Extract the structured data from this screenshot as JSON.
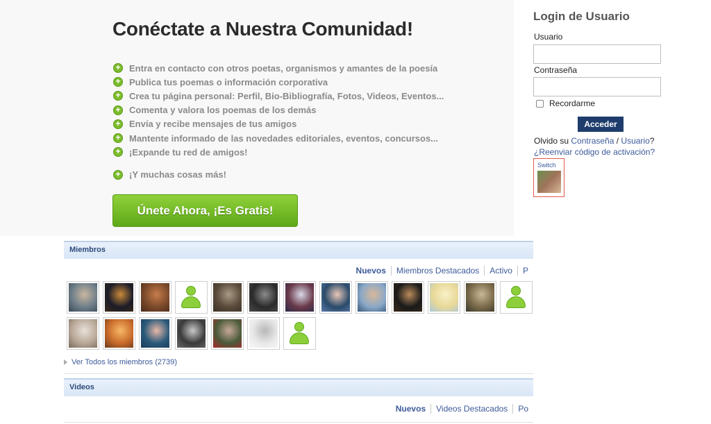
{
  "hero": {
    "title": "Conéctate a Nuestra Comunidad!",
    "features": [
      "Entra en contacto con otros poetas, organismos y amantes de la poesía",
      "Publica tus poemas o información corporativa",
      "Crea tu página personal: Perfil, Bio-Bibliografía, Fotos, Videos, Eventos...",
      "Comenta y valora los poemas de los demás",
      "Envía y recibe mensajes de tus amigos",
      "Mantente informado de las novedades editoriales, eventos, concursos...",
      "¡Expande tu red de amigos!"
    ],
    "more": "¡Y muchas cosas más!",
    "join_label": "Únete Ahora, ¡Es Gratis!",
    "plus_glyph": "+"
  },
  "login": {
    "title": "Login de Usuario",
    "user_label": "Usuario",
    "password_label": "Contraseña",
    "remember_label": "Recordarme",
    "submit_label": "Acceder",
    "forgot_prefix": "Olvido su ",
    "forgot_password": "Contraseña",
    "forgot_sep": " / ",
    "forgot_user": "Usuario",
    "forgot_suffix": "?",
    "resend": "¿Reenviar código de activación?",
    "switch_label": "Switch"
  },
  "members": {
    "title": "Miembros",
    "tabs": [
      "Nuevos",
      "Miembros Destacados",
      "Activo",
      "P"
    ],
    "view_all": "Ver Todos los miembros (2739)",
    "thumbs": [
      {
        "type": "photo",
        "colors": [
          "#6f7f8a",
          "#c9b7a0",
          "#3a4a55"
        ]
      },
      {
        "type": "photo",
        "colors": [
          "#1c1c28",
          "#c98a3a",
          "#3a2a1a"
        ]
      },
      {
        "type": "photo",
        "colors": [
          "#7a4a2a",
          "#c77b4a",
          "#4a2a1a"
        ]
      },
      {
        "type": "default"
      },
      {
        "type": "photo",
        "colors": [
          "#5a4a3a",
          "#a89a85",
          "#3a3228"
        ]
      },
      {
        "type": "photo",
        "colors": [
          "#2a2a2a",
          "#8a8a8a",
          "#4a4a4a"
        ]
      },
      {
        "type": "photo",
        "colors": [
          "#6a3a4a",
          "#d8d8e8",
          "#2a2a4a"
        ]
      },
      {
        "type": "photo",
        "colors": [
          "#2a4a6a",
          "#e8c8b8",
          "#5a7aa8"
        ]
      },
      {
        "type": "photo",
        "colors": [
          "#8aa8c8",
          "#d8b898",
          "#3a5a7a"
        ]
      },
      {
        "type": "photo",
        "colors": [
          "#1a1a1a",
          "#b88a5a",
          "#3a2a1a"
        ]
      },
      {
        "type": "photo",
        "colors": [
          "#e8d898",
          "#f8f0c8",
          "#a8c8d8"
        ]
      },
      {
        "type": "photo",
        "colors": [
          "#7a6a4a",
          "#c8b898",
          "#3a3a2a"
        ]
      },
      {
        "type": "default"
      },
      {
        "type": "photo",
        "colors": [
          "#b8a898",
          "#e8e0d8",
          "#7a6a5a"
        ]
      },
      {
        "type": "photo",
        "colors": [
          "#c86a2a",
          "#f8b868",
          "#6a3a1a"
        ]
      },
      {
        "type": "photo",
        "colors": [
          "#2a5a7a",
          "#e8b8a8",
          "#1a3a5a"
        ]
      },
      {
        "type": "photo",
        "colors": [
          "#3a3a3a",
          "#c8c8c8",
          "#6a6a6a"
        ]
      },
      {
        "type": "photo",
        "colors": [
          "#4a5a3a",
          "#c8a898",
          "#a82a2a"
        ]
      },
      {
        "type": "photo",
        "colors": [
          "#e8e8e8",
          "#b8b8b8",
          "#f8f8f8"
        ]
      },
      {
        "type": "default"
      }
    ]
  },
  "videos": {
    "title": "Videos",
    "tabs": [
      "Nuevos",
      "Videos Destacados",
      "Po"
    ]
  }
}
